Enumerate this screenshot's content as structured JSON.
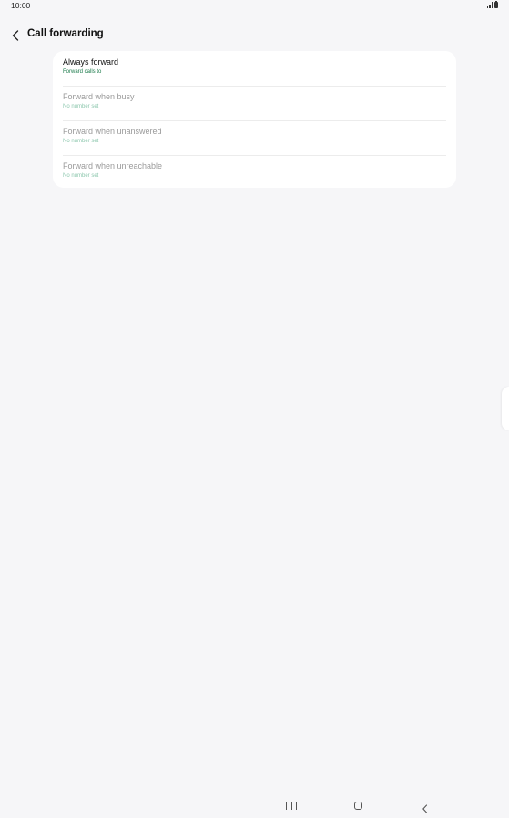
{
  "status_bar": {
    "time": "10:00",
    "icons": [
      "signal-icon",
      "battery-icon"
    ]
  },
  "header": {
    "back_icon": "chevron-left-icon",
    "title": "Call forwarding"
  },
  "forwarding_options": [
    {
      "title": "Always forward",
      "subtitle": "Forward calls to",
      "enabled": true
    },
    {
      "title": "Forward when busy",
      "subtitle": "No number set",
      "enabled": false
    },
    {
      "title": "Forward when unanswered",
      "subtitle": "No number set",
      "enabled": false
    },
    {
      "title": "Forward when unreachable",
      "subtitle": "No number set",
      "enabled": false
    }
  ],
  "navigation_bar": {
    "icons": [
      "recent-apps-icon",
      "home-icon",
      "back-icon"
    ]
  },
  "colors": {
    "background": "#f6f6f8",
    "card": "#ffffff",
    "accent": "#1a7a4a",
    "disabled_text": "#9a9a9a",
    "disabled_accent": "#8cc7ad"
  }
}
